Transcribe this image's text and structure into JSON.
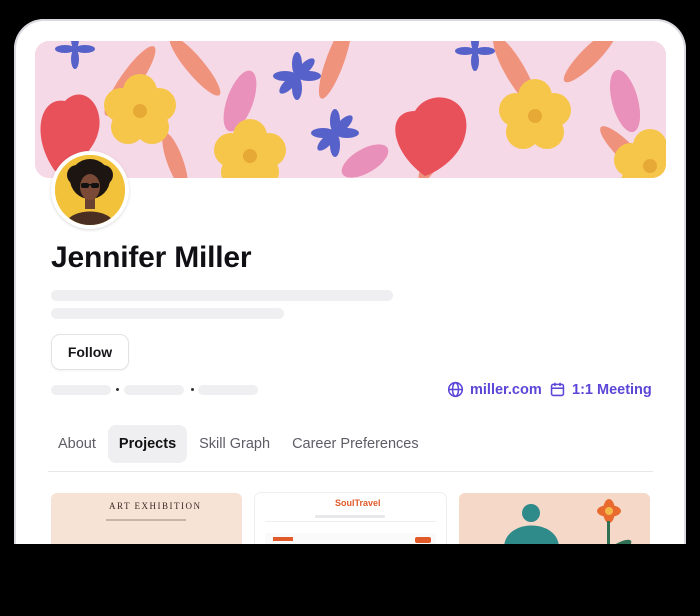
{
  "profile": {
    "name": "Jennifer Miller",
    "follow_label": "Follow",
    "website_label": "miller.com",
    "meeting_label": "1:1 Meeting"
  },
  "tabs": [
    {
      "label": "About",
      "active": false
    },
    {
      "label": "Projects",
      "active": true
    },
    {
      "label": "Skill Graph",
      "active": false
    },
    {
      "label": "Career Preferences",
      "active": false
    }
  ],
  "projects": [
    {
      "title": "ART EXHIBITION"
    },
    {
      "title": "SoulTravel"
    },
    {
      "title": ""
    }
  ],
  "colors": {
    "accent": "#5b46d8",
    "banner_bg": "#f5d7e4",
    "avatar_bg": "#f2c23a",
    "skeleton": "#efeff1"
  },
  "icons": {
    "website": "globe-icon",
    "meeting": "calendar-icon"
  }
}
